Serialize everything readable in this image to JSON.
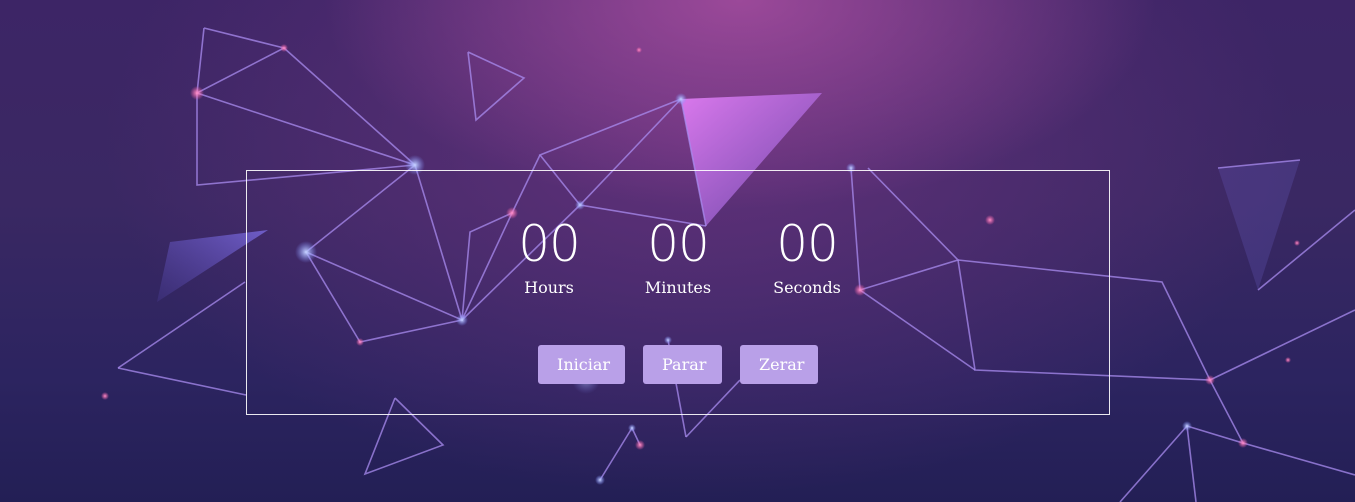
{
  "timer": {
    "hours": "00",
    "minutes": "00",
    "seconds": "00",
    "hours_label": "Hours",
    "minutes_label": "Minutes",
    "seconds_label": "Seconds"
  },
  "controls": {
    "start_label": "Iniciar",
    "stop_label": "Parar",
    "reset_label": "Zerar"
  },
  "colors": {
    "button_bg": "#b9a0e8",
    "frame_border": "#ffffff",
    "background_top": "#6e3482",
    "background_bottom": "#231f55"
  }
}
